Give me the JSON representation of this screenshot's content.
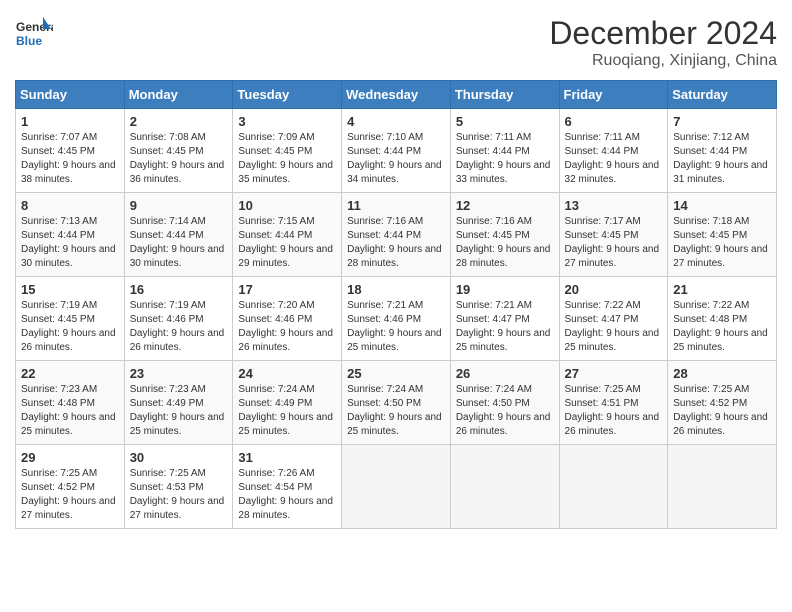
{
  "logo": {
    "line1": "General",
    "line2": "Blue"
  },
  "title": "December 2024",
  "subtitle": "Ruoqiang, Xinjiang, China",
  "weekdays": [
    "Sunday",
    "Monday",
    "Tuesday",
    "Wednesday",
    "Thursday",
    "Friday",
    "Saturday"
  ],
  "weeks": [
    [
      {
        "day": "1",
        "sunrise": "Sunrise: 7:07 AM",
        "sunset": "Sunset: 4:45 PM",
        "daylight": "Daylight: 9 hours and 38 minutes."
      },
      {
        "day": "2",
        "sunrise": "Sunrise: 7:08 AM",
        "sunset": "Sunset: 4:45 PM",
        "daylight": "Daylight: 9 hours and 36 minutes."
      },
      {
        "day": "3",
        "sunrise": "Sunrise: 7:09 AM",
        "sunset": "Sunset: 4:45 PM",
        "daylight": "Daylight: 9 hours and 35 minutes."
      },
      {
        "day": "4",
        "sunrise": "Sunrise: 7:10 AM",
        "sunset": "Sunset: 4:44 PM",
        "daylight": "Daylight: 9 hours and 34 minutes."
      },
      {
        "day": "5",
        "sunrise": "Sunrise: 7:11 AM",
        "sunset": "Sunset: 4:44 PM",
        "daylight": "Daylight: 9 hours and 33 minutes."
      },
      {
        "day": "6",
        "sunrise": "Sunrise: 7:11 AM",
        "sunset": "Sunset: 4:44 PM",
        "daylight": "Daylight: 9 hours and 32 minutes."
      },
      {
        "day": "7",
        "sunrise": "Sunrise: 7:12 AM",
        "sunset": "Sunset: 4:44 PM",
        "daylight": "Daylight: 9 hours and 31 minutes."
      }
    ],
    [
      {
        "day": "8",
        "sunrise": "Sunrise: 7:13 AM",
        "sunset": "Sunset: 4:44 PM",
        "daylight": "Daylight: 9 hours and 30 minutes."
      },
      {
        "day": "9",
        "sunrise": "Sunrise: 7:14 AM",
        "sunset": "Sunset: 4:44 PM",
        "daylight": "Daylight: 9 hours and 30 minutes."
      },
      {
        "day": "10",
        "sunrise": "Sunrise: 7:15 AM",
        "sunset": "Sunset: 4:44 PM",
        "daylight": "Daylight: 9 hours and 29 minutes."
      },
      {
        "day": "11",
        "sunrise": "Sunrise: 7:16 AM",
        "sunset": "Sunset: 4:44 PM",
        "daylight": "Daylight: 9 hours and 28 minutes."
      },
      {
        "day": "12",
        "sunrise": "Sunrise: 7:16 AM",
        "sunset": "Sunset: 4:45 PM",
        "daylight": "Daylight: 9 hours and 28 minutes."
      },
      {
        "day": "13",
        "sunrise": "Sunrise: 7:17 AM",
        "sunset": "Sunset: 4:45 PM",
        "daylight": "Daylight: 9 hours and 27 minutes."
      },
      {
        "day": "14",
        "sunrise": "Sunrise: 7:18 AM",
        "sunset": "Sunset: 4:45 PM",
        "daylight": "Daylight: 9 hours and 27 minutes."
      }
    ],
    [
      {
        "day": "15",
        "sunrise": "Sunrise: 7:19 AM",
        "sunset": "Sunset: 4:45 PM",
        "daylight": "Daylight: 9 hours and 26 minutes."
      },
      {
        "day": "16",
        "sunrise": "Sunrise: 7:19 AM",
        "sunset": "Sunset: 4:46 PM",
        "daylight": "Daylight: 9 hours and 26 minutes."
      },
      {
        "day": "17",
        "sunrise": "Sunrise: 7:20 AM",
        "sunset": "Sunset: 4:46 PM",
        "daylight": "Daylight: 9 hours and 26 minutes."
      },
      {
        "day": "18",
        "sunrise": "Sunrise: 7:21 AM",
        "sunset": "Sunset: 4:46 PM",
        "daylight": "Daylight: 9 hours and 25 minutes."
      },
      {
        "day": "19",
        "sunrise": "Sunrise: 7:21 AM",
        "sunset": "Sunset: 4:47 PM",
        "daylight": "Daylight: 9 hours and 25 minutes."
      },
      {
        "day": "20",
        "sunrise": "Sunrise: 7:22 AM",
        "sunset": "Sunset: 4:47 PM",
        "daylight": "Daylight: 9 hours and 25 minutes."
      },
      {
        "day": "21",
        "sunrise": "Sunrise: 7:22 AM",
        "sunset": "Sunset: 4:48 PM",
        "daylight": "Daylight: 9 hours and 25 minutes."
      }
    ],
    [
      {
        "day": "22",
        "sunrise": "Sunrise: 7:23 AM",
        "sunset": "Sunset: 4:48 PM",
        "daylight": "Daylight: 9 hours and 25 minutes."
      },
      {
        "day": "23",
        "sunrise": "Sunrise: 7:23 AM",
        "sunset": "Sunset: 4:49 PM",
        "daylight": "Daylight: 9 hours and 25 minutes."
      },
      {
        "day": "24",
        "sunrise": "Sunrise: 7:24 AM",
        "sunset": "Sunset: 4:49 PM",
        "daylight": "Daylight: 9 hours and 25 minutes."
      },
      {
        "day": "25",
        "sunrise": "Sunrise: 7:24 AM",
        "sunset": "Sunset: 4:50 PM",
        "daylight": "Daylight: 9 hours and 25 minutes."
      },
      {
        "day": "26",
        "sunrise": "Sunrise: 7:24 AM",
        "sunset": "Sunset: 4:50 PM",
        "daylight": "Daylight: 9 hours and 26 minutes."
      },
      {
        "day": "27",
        "sunrise": "Sunrise: 7:25 AM",
        "sunset": "Sunset: 4:51 PM",
        "daylight": "Daylight: 9 hours and 26 minutes."
      },
      {
        "day": "28",
        "sunrise": "Sunrise: 7:25 AM",
        "sunset": "Sunset: 4:52 PM",
        "daylight": "Daylight: 9 hours and 26 minutes."
      }
    ],
    [
      {
        "day": "29",
        "sunrise": "Sunrise: 7:25 AM",
        "sunset": "Sunset: 4:52 PM",
        "daylight": "Daylight: 9 hours and 27 minutes."
      },
      {
        "day": "30",
        "sunrise": "Sunrise: 7:25 AM",
        "sunset": "Sunset: 4:53 PM",
        "daylight": "Daylight: 9 hours and 27 minutes."
      },
      {
        "day": "31",
        "sunrise": "Sunrise: 7:26 AM",
        "sunset": "Sunset: 4:54 PM",
        "daylight": "Daylight: 9 hours and 28 minutes."
      },
      null,
      null,
      null,
      null
    ]
  ]
}
